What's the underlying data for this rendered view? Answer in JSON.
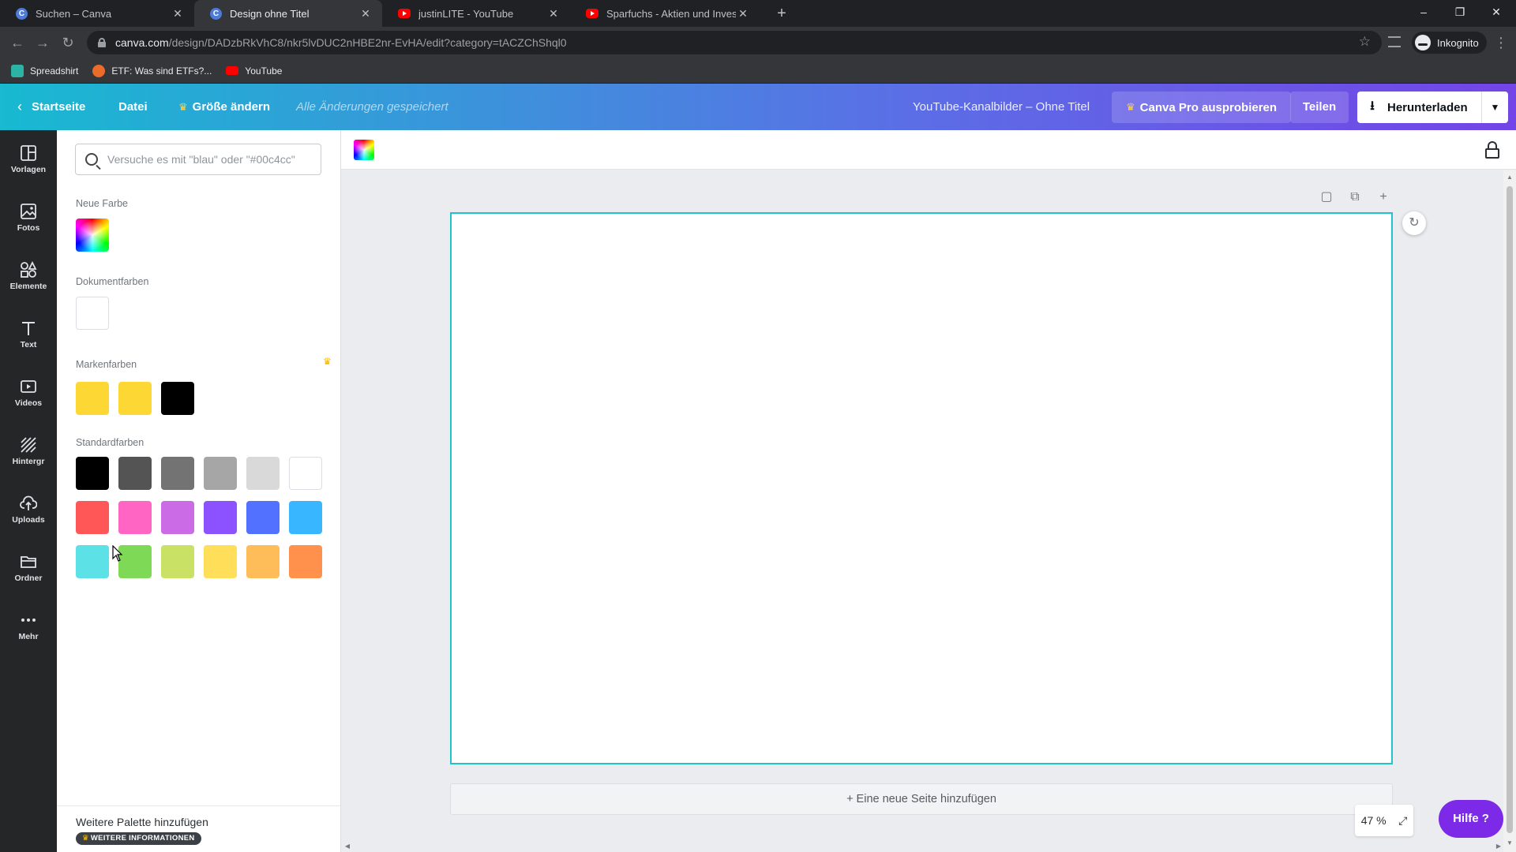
{
  "browser": {
    "tabs": [
      {
        "title": "Suchen – Canva",
        "icon": "canva-icon",
        "active": false
      },
      {
        "title": "Design ohne Titel",
        "icon": "canva-icon",
        "active": true
      },
      {
        "title": "justinLITE - YouTube",
        "icon": "youtube-icon",
        "active": false
      },
      {
        "title": "Sparfuchs - Aktien und Investme",
        "icon": "youtube-icon",
        "active": false
      }
    ],
    "url_host": "canva.com",
    "url_path": "/design/DADzbRkVhC8/nkr5lvDUC2nHBE2nr-EvHA/edit?category=tACZChShql0",
    "profile_label": "Inkognito",
    "bookmarks": [
      {
        "label": "Spreadshirt",
        "color": "#2bb3a3"
      },
      {
        "label": "ETF: Was sind ETFs?...",
        "color": "#ea6b2a"
      },
      {
        "label": "YouTube",
        "color": "#ff0000"
      }
    ]
  },
  "header": {
    "home": "Startseite",
    "file": "Datei",
    "resize": "Größe ändern",
    "saved_status": "Alle Änderungen gespeichert",
    "doc_title": "YouTube-Kanalbilder – Ohne Titel",
    "pro": "Canva Pro ausprobieren",
    "share": "Teilen",
    "download": "Herunterladen"
  },
  "rail": [
    {
      "label": "Vorlagen",
      "icon": "templates-icon"
    },
    {
      "label": "Fotos",
      "icon": "photos-icon"
    },
    {
      "label": "Elemente",
      "icon": "elements-icon"
    },
    {
      "label": "Text",
      "icon": "text-icon"
    },
    {
      "label": "Videos",
      "icon": "videos-icon"
    },
    {
      "label": "Hintergr",
      "icon": "background-icon"
    },
    {
      "label": "Uploads",
      "icon": "uploads-icon"
    },
    {
      "label": "Ordner",
      "icon": "folder-icon"
    },
    {
      "label": "Mehr",
      "icon": "more-icon"
    }
  ],
  "panel": {
    "search_placeholder": "Versuche es mit \"blau\" oder \"#00c4cc\"",
    "new_color_label": "Neue Farbe",
    "document_colors_label": "Dokumentfarben",
    "document_colors": [
      "#ffffff"
    ],
    "brand_colors_label": "Markenfarben",
    "brand_colors": [
      "#fdd835",
      "#fdd835",
      "#000000"
    ],
    "standard_colors_label": "Standardfarben",
    "standard_colors": [
      [
        "#000000",
        "#545454",
        "#737373",
        "#a6a6a6",
        "#d9d9d9",
        "#ffffff"
      ],
      [
        "#ff5757",
        "#ff66c4",
        "#cb6ce6",
        "#8c52ff",
        "#5271ff",
        "#38b6ff"
      ],
      [
        "#5ce1e6",
        "#7ed957",
        "#c9e265",
        "#ffde59",
        "#ffbd59",
        "#ff914d"
      ]
    ],
    "more_palette": "Weitere Palette hinzufügen",
    "more_info": "WEITERE INFORMATIONEN"
  },
  "editor": {
    "add_page": "+ Eine neue Seite hinzufügen",
    "zoom": "47 %",
    "help": "Hilfe ?"
  }
}
